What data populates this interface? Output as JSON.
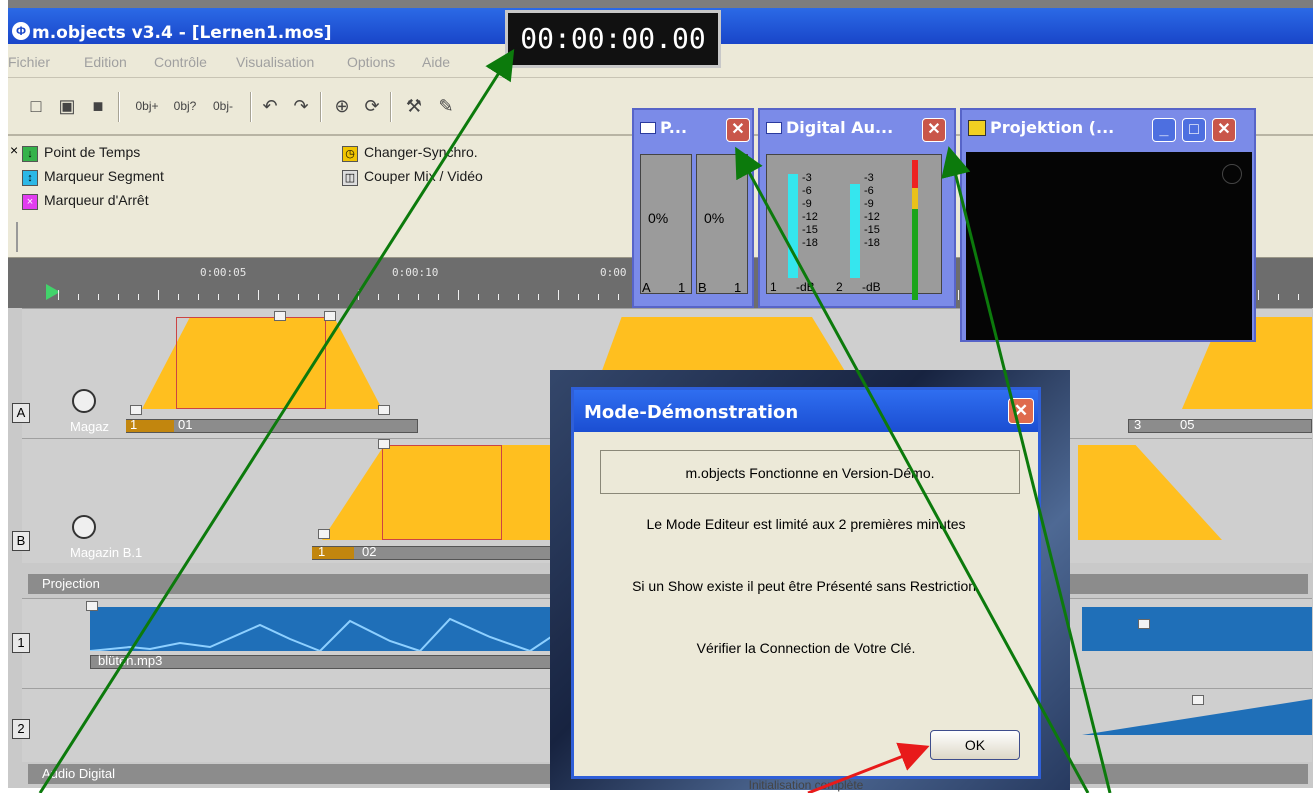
{
  "app": {
    "title": "m.objects v3.4 - [Lernen1.mos]",
    "logo": "m.objects-logo-icon"
  },
  "timecode": "00:00:00.00",
  "menu": [
    "Fichier",
    "Edition",
    "Contrôle",
    "Visualisation",
    "Options",
    "Aide"
  ],
  "toolbar": {
    "new": "□",
    "open": "▣",
    "save": "■",
    "obj1": "0bj+",
    "obj2": "0bj?",
    "obj3": "0bj-",
    "undo": "↶",
    "redo": "↷",
    "icon1": "⊕",
    "icon2": "⟳",
    "tool1": "⚒",
    "tool2": "✎"
  },
  "legend": {
    "close": "×",
    "items": [
      {
        "label": "Point de Temps",
        "symbol": "↓",
        "color": "#35b24a"
      },
      {
        "label": "Marqueur Segment",
        "symbol": "↕",
        "color": "#2cb8e7"
      },
      {
        "label": "Marqueur d'Arrêt",
        "symbol": "×",
        "color": "#e13df0"
      },
      {
        "label": "Changer-Synchro.",
        "symbol": "◷",
        "color": "#f0c400"
      },
      {
        "label": "Couper Mix / Vidéo",
        "symbol": "◫",
        "color": "#5d5d5d"
      }
    ]
  },
  "ruler": {
    "labels": [
      "0:00:05",
      "0:00:10",
      "0:00"
    ]
  },
  "lanes": {
    "a_letter": "A",
    "a_name": "Magaz",
    "a_slide1": "01",
    "a_slide1_index": "1",
    "a_slide_end": "05",
    "a_slide_end_index": "3",
    "b_letter": "B",
    "b_name": "Magazin B.1",
    "b_slide": "02",
    "b_slide_index": "1",
    "projection": "Projection",
    "audio1_letter": "1",
    "audio1_file": "blüten.mp3",
    "audio2_letter": "2",
    "audio_section": "Audio Digital",
    "status": "Initialisation complète"
  },
  "floats": {
    "p_title": "P...",
    "p_a": "A",
    "p_a_num": "1",
    "p_b": "B",
    "p_b_num": "1",
    "p_left_percent": "0%",
    "p_right_percent": "0%",
    "digital_title": "Digital Au...",
    "meter_labels": [
      "-3",
      "-6",
      "-9",
      "-12",
      "-15",
      "-18"
    ],
    "ch1": "1",
    "ch1_db": "-dB",
    "ch2": "2",
    "ch2_db": "-dB",
    "projektion_title": "Projektion (..."
  },
  "dialog": {
    "title": "Mode-Démonstration",
    "line1": "m.objects Fonctionne en Version-Démo.",
    "line2": "Le Mode Editeur est limité aux 2 premières minutes",
    "line3": "Si un Show existe il peut être Présenté sans Restriction.",
    "line4": "Vérifier la Connection de Votre Clé.",
    "ok": "OK"
  },
  "colors": {
    "slide": "#ffbf1f",
    "title": "#1946c9",
    "arrow_green": "#0c7a0c",
    "arrow_red": "#e81a1a"
  }
}
